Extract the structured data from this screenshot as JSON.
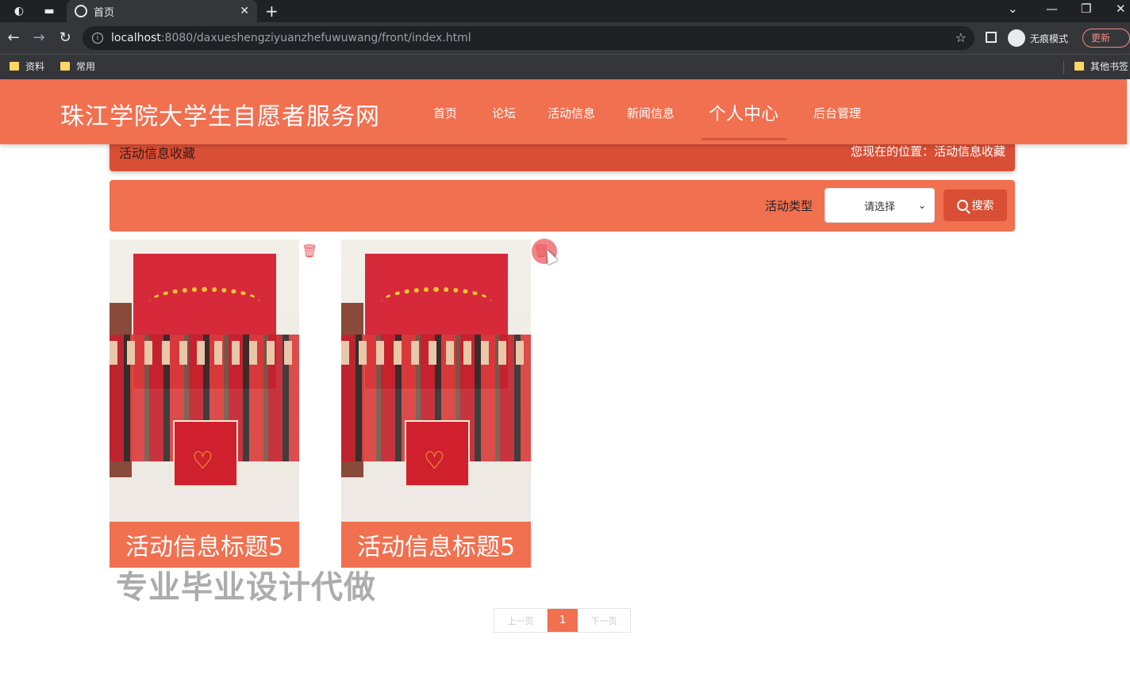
{
  "browser": {
    "tab_title": "首页",
    "url_host": "localhost",
    "url_path": ":8080/daxueshengziyuanzhefuwuwang/front/index.html",
    "incognito_label": "无痕模式",
    "update_label": "更新",
    "bookmarks": [
      "资料",
      "常用"
    ],
    "other_bookmarks": "其他书签"
  },
  "site": {
    "title": "珠江学院大学生自愿者服务网",
    "nav": [
      "首页",
      "论坛",
      "活动信息",
      "新闻信息",
      "个人中心",
      "后台管理"
    ],
    "active_nav": "个人中心"
  },
  "breadcrumb": {
    "page_name": "活动信息收藏",
    "location": "您现在的位置：活动信息收藏"
  },
  "search": {
    "label": "活动类型",
    "select_value": "请选择",
    "button_label": "搜索"
  },
  "cards": [
    {
      "title": "活动信息标题5"
    },
    {
      "title": "活动信息标题5"
    }
  ],
  "watermark": "专业毕业设计代做",
  "pagination": {
    "prev": "上一页",
    "current": "1",
    "next": "下一页"
  },
  "colors": {
    "primary": "#f07050",
    "dark_primary": "#d94f35"
  }
}
